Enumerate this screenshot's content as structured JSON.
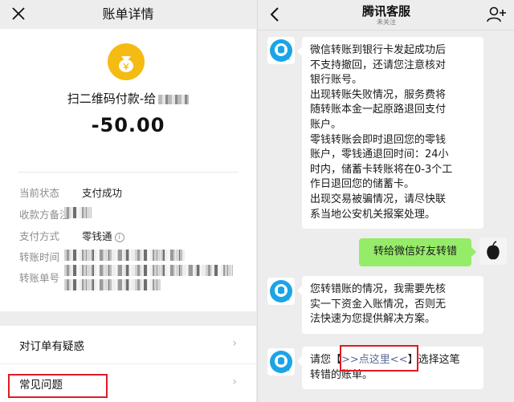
{
  "left": {
    "title": "账单详情",
    "merchant": "扫二维码付款-给",
    "amount": "-50.00",
    "details": [
      {
        "label": "当前状态",
        "value": "支付成功"
      },
      {
        "label": "收款方备注",
        "value": ""
      },
      {
        "label": "支付方式",
        "value": "零钱通"
      },
      {
        "label": "转账时间",
        "value": ""
      },
      {
        "label": "转账单号",
        "value": ""
      }
    ],
    "menu": [
      {
        "label": "对订单有疑惑"
      },
      {
        "label": "常见问题"
      }
    ],
    "info_glyph": "i",
    "chevron": "›"
  },
  "right": {
    "title": "腾讯客服",
    "subtitle": "未关注",
    "messages": [
      {
        "from": "service",
        "lines": [
          "微信转账到银行卡发起成功后",
          "不支持撤回，还请您注意核对",
          "银行账号。",
          "出现转账失败情况，服务费将",
          "随转账本金一起原路退回支付",
          "账户。",
          "零钱转账会即时退回您的零钱",
          "账户，零钱通退回时间：24小",
          "时内，储蓄卡转账将在0-3个工",
          "作日退回您的储蓄卡。",
          "出现交易被骗情况，请尽快联",
          "系当地公安机关报案处理。"
        ]
      },
      {
        "from": "me",
        "lines": [
          "转给微信好友转错"
        ]
      },
      {
        "from": "service",
        "lines": [
          "您转错账的情况，我需要先核",
          "实一下资金入账情况，否则无",
          "法快速为您提供解决方案。"
        ]
      },
      {
        "from": "service",
        "prefix": "请您【",
        "link": ">>点这里<<",
        "suffix": "】选择这笔",
        "line2": "转错的账单。"
      }
    ]
  },
  "colors": {
    "accent_green": "#95ec69",
    "logo_yellow": "#f5bb12",
    "highlight_red": "#e01b24",
    "link_blue": "#576b95"
  },
  "icons": {
    "close": "close-icon",
    "back": "back-icon",
    "add_user": "add-user-icon",
    "money_bag": "money-bag-icon",
    "service_avatar": "service-avatar-icon"
  }
}
